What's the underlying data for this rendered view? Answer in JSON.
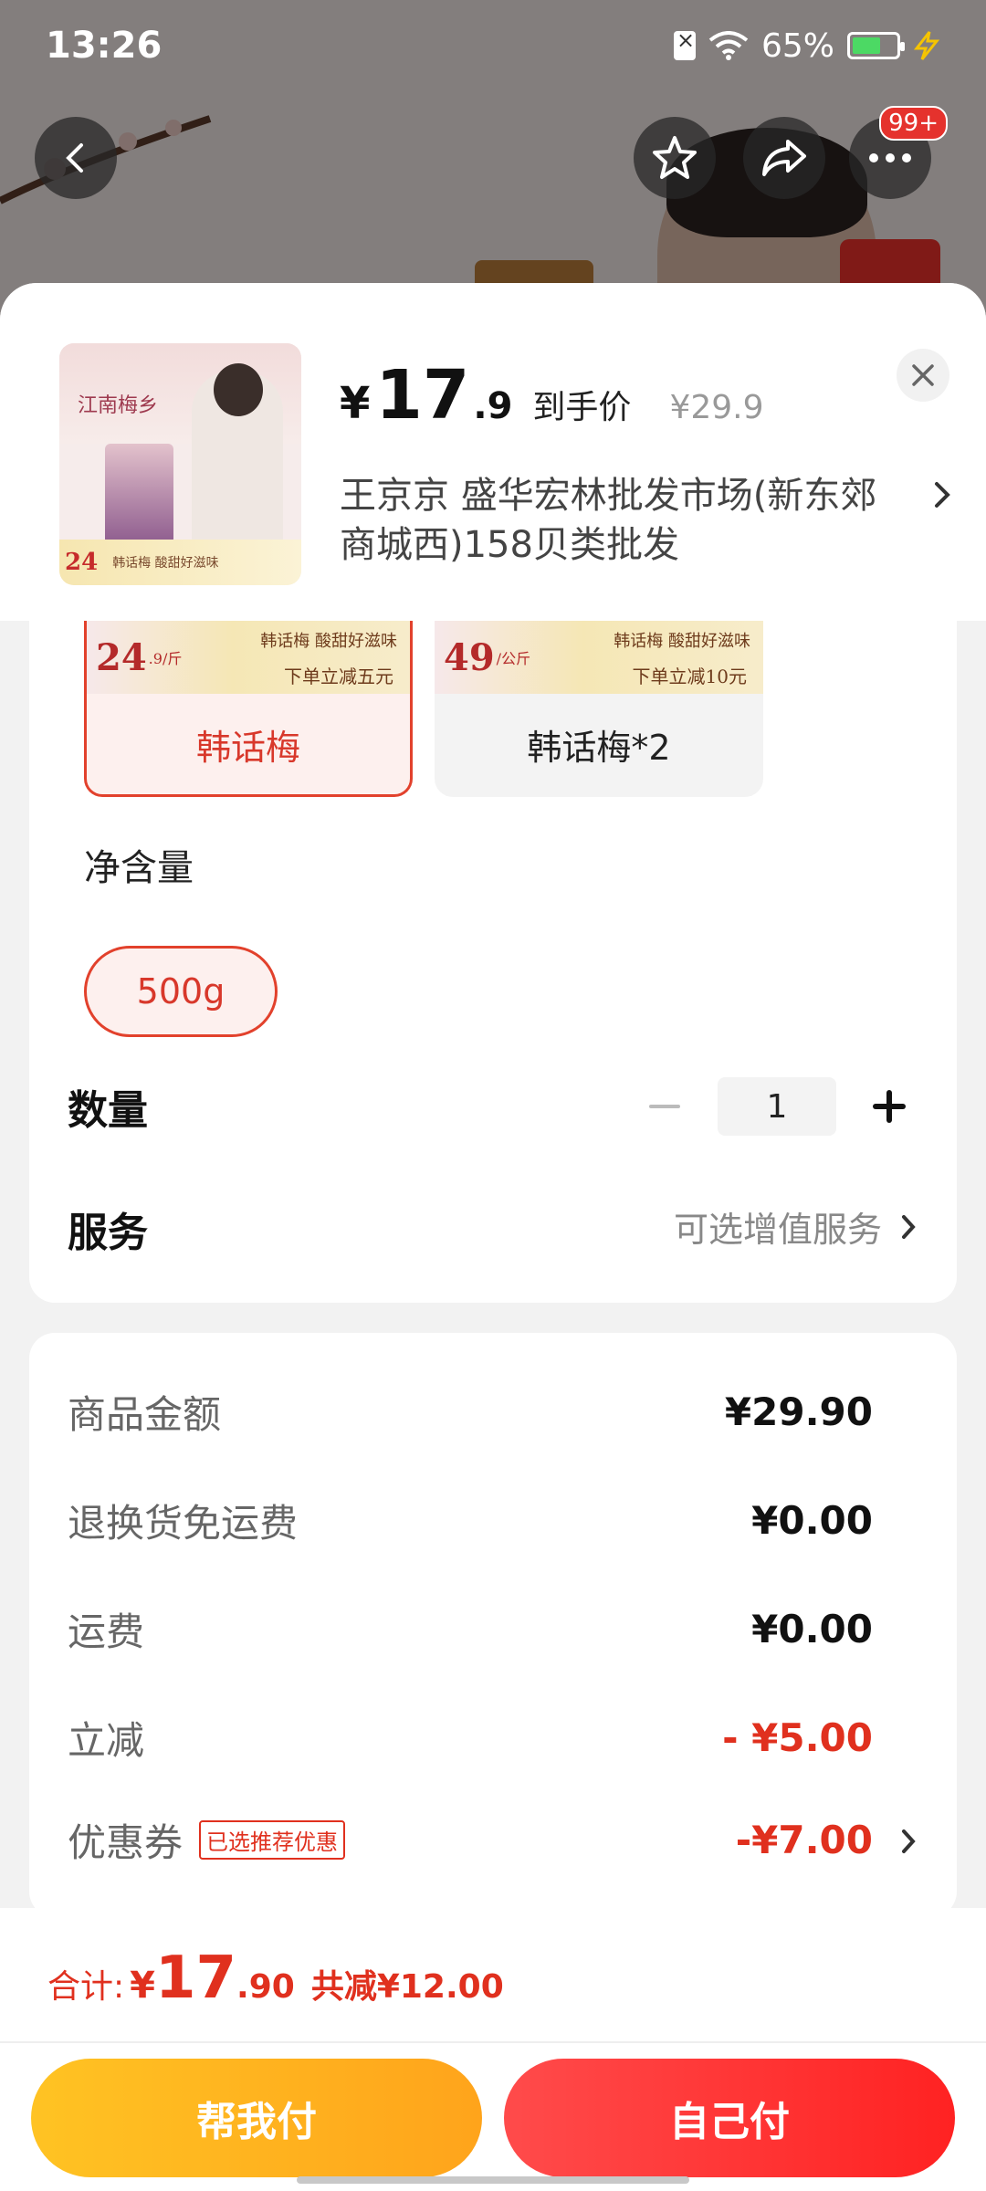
{
  "status_bar": {
    "time": "13:26",
    "battery": "65%"
  },
  "nav": {
    "more_badge": "99+"
  },
  "product": {
    "thumb": {
      "title": "江南梅乡",
      "price": "24",
      "note": "韩话梅 酸甜好滋味"
    },
    "price_currency": "¥",
    "price_int": "17",
    "price_dec": ".9",
    "price_label": "到手价",
    "original_price": "¥29.9",
    "store": "王京京  盛华宏林批发市场(新东郊商城西)158贝类批发"
  },
  "variants": [
    {
      "label": "韩话梅",
      "banner_price": "24",
      "banner_unit": ".9/斤",
      "banner_tag": "韩话梅 酸甜好滋味",
      "banner_sub": "下单立减五元",
      "selected": true
    },
    {
      "label": "韩话梅*2",
      "banner_price": "49",
      "banner_unit": "/公斤",
      "banner_tag": "韩话梅 酸甜好滋味",
      "banner_sub": "下单立减10元",
      "selected": false
    }
  ],
  "net_content": {
    "title": "净含量",
    "option": "500g"
  },
  "quantity": {
    "title": "数量",
    "value": "1"
  },
  "service": {
    "title": "服务",
    "hint": "可选增值服务"
  },
  "prices": {
    "goods_label": "商品金额",
    "goods_value": "¥29.90",
    "return_label": "退换货免运费",
    "return_value": "¥0.00",
    "shipping_label": "运费",
    "shipping_value": "¥0.00",
    "discount_label": "立减",
    "discount_value": "- ¥5.00",
    "coupon_label": "优惠券",
    "coupon_tag": "已选推荐优惠",
    "coupon_value": "-¥7.00"
  },
  "footer": {
    "total_label": "合计:",
    "total_currency": "¥",
    "total_int": "17",
    "total_dec": ".90",
    "total_saved": "共减¥12.00",
    "help_pay": "帮我付",
    "self_pay": "自己付"
  },
  "colors": {
    "accent_red": "#e0301e",
    "selected_border": "#e2412c",
    "help_btn": "#ffb21f",
    "self_btn": "#ff3333"
  }
}
